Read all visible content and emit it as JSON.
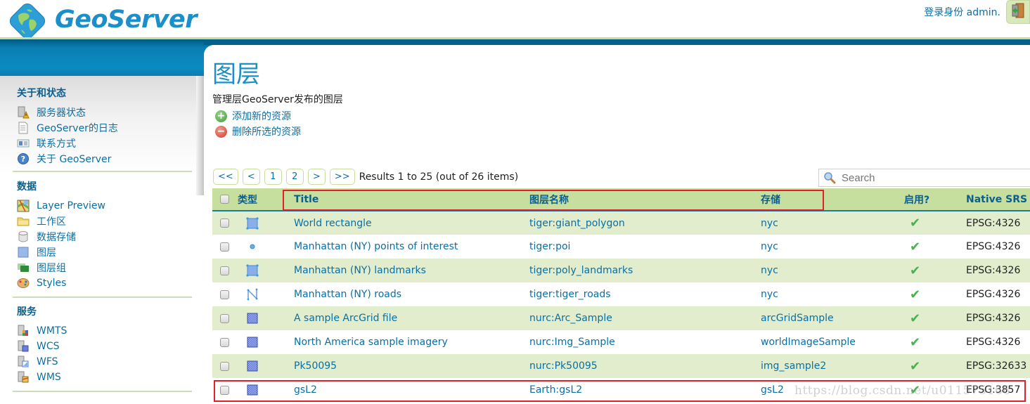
{
  "header": {
    "logo_text": "GeoServer",
    "login_text": "登录身份 admin.",
    "logout_icon": "logout-door-icon"
  },
  "sidebar": {
    "sections": [
      {
        "title": "关于和状态",
        "items": [
          {
            "label": "服务器状态",
            "icon": "server-status-icon"
          },
          {
            "label": "GeoServer的日志",
            "icon": "log-document-icon"
          },
          {
            "label": "联系方式",
            "icon": "contact-card-icon"
          },
          {
            "label": "关于 GeoServer",
            "icon": "help-icon"
          }
        ]
      },
      {
        "title": "数据",
        "items": [
          {
            "label": "Layer Preview",
            "icon": "map-preview-icon"
          },
          {
            "label": "工作区",
            "icon": "folder-icon"
          },
          {
            "label": "数据存储",
            "icon": "database-icon"
          },
          {
            "label": "图层",
            "icon": "layer-icon"
          },
          {
            "label": "图层组",
            "icon": "layer-group-icon"
          },
          {
            "label": "Styles",
            "icon": "palette-icon"
          }
        ]
      },
      {
        "title": "服务",
        "items": [
          {
            "label": "WMTS",
            "icon": "wmts-service-icon"
          },
          {
            "label": "WCS",
            "icon": "wcs-service-icon"
          },
          {
            "label": "WFS",
            "icon": "wfs-service-icon"
          },
          {
            "label": "WMS",
            "icon": "wms-service-icon"
          }
        ]
      }
    ]
  },
  "main": {
    "title": "图层",
    "description": "管理层GeoServer发布的图层",
    "actions": {
      "add": "添加新的资源",
      "remove": "删除所选的资源"
    },
    "pager": {
      "first": "<<",
      "prev": "<",
      "page1": "1",
      "page2": "2",
      "next": ">",
      "last": ">>",
      "results": "Results 1 to 25 (out of 26 items)"
    },
    "search": {
      "placeholder": "Search",
      "value": ""
    },
    "table": {
      "headers": {
        "type": "类型",
        "title": "Title",
        "name": "图层名称",
        "store": "存储",
        "enabled": "启用?",
        "srs": "Native SRS"
      },
      "rows": [
        {
          "type": "polygon",
          "title": "World rectangle",
          "name": "tiger:giant_polygon",
          "store": "nyc",
          "enabled": true,
          "srs": "EPSG:4326"
        },
        {
          "type": "point",
          "title": "Manhattan (NY) points of interest",
          "name": "tiger:poi",
          "store": "nyc",
          "enabled": true,
          "srs": "EPSG:4326"
        },
        {
          "type": "polygon",
          "title": "Manhattan (NY) landmarks",
          "name": "tiger:poly_landmarks",
          "store": "nyc",
          "enabled": true,
          "srs": "EPSG:4326"
        },
        {
          "type": "line",
          "title": "Manhattan (NY) roads",
          "name": "tiger:tiger_roads",
          "store": "nyc",
          "enabled": true,
          "srs": "EPSG:4326"
        },
        {
          "type": "raster",
          "title": "A sample ArcGrid file",
          "name": "nurc:Arc_Sample",
          "store": "arcGridSample",
          "enabled": true,
          "srs": "EPSG:4326"
        },
        {
          "type": "raster",
          "title": "North America sample imagery",
          "name": "nurc:Img_Sample",
          "store": "worldImageSample",
          "enabled": true,
          "srs": "EPSG:4326"
        },
        {
          "type": "raster",
          "title": "Pk50095",
          "name": "nurc:Pk50095",
          "store": "img_sample2",
          "enabled": true,
          "srs": "EPSG:32633"
        },
        {
          "type": "raster",
          "title": "gsL2",
          "name": "Earth:gsL2",
          "store": "gsL2",
          "enabled": true,
          "srs": "EPSG:3857"
        }
      ]
    }
  },
  "watermark": "https://blog.csdn.net/u011575168",
  "colors": {
    "brand_blue": "#1a8fc9",
    "link": "#0b6fa4",
    "header_green": "#c6de9e",
    "row_alt": "#e1edcc",
    "highlight_red": "#e0202a"
  }
}
